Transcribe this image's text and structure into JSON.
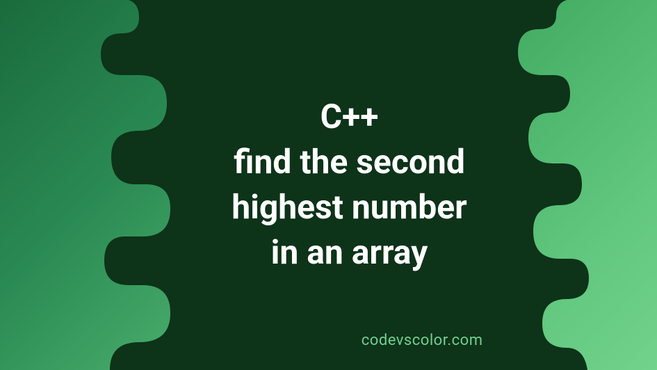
{
  "title": {
    "line1": "C++",
    "line2": "find the second",
    "line3": "highest number",
    "line4": "in an array"
  },
  "footer_text": "codevscolor.com",
  "colors": {
    "background_dark": "#0d3319",
    "text_white": "#ffffff",
    "accent_green": "#6fd091",
    "blob_light_start": "#5fc57d",
    "blob_light_end": "#72d38b",
    "blob_dark_start": "#1a6b3d",
    "blob_dark_end": "#4db26f"
  }
}
